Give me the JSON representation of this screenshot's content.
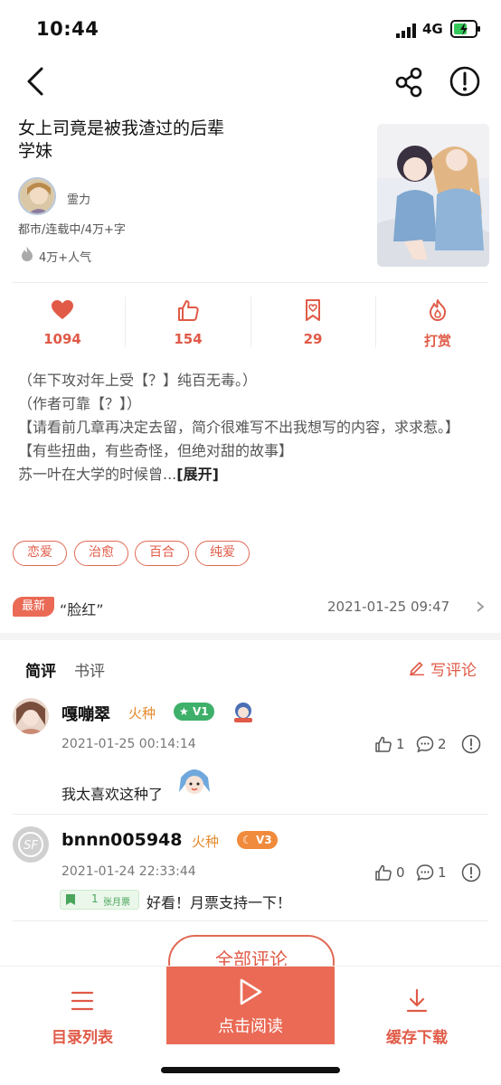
{
  "status": {
    "time": "10:44",
    "network": "4G"
  },
  "book": {
    "title": "女上司竟是被我渣过的后辈学妹",
    "author": "霊力",
    "meta": "都市/连载中/4万+字",
    "popularity": "4万+人气"
  },
  "stats": [
    {
      "value": "1094",
      "icon": "heart-icon"
    },
    {
      "value": "154",
      "icon": "thumbs-up-icon"
    },
    {
      "value": "29",
      "icon": "bookmark-ticket-icon"
    },
    {
      "value": "打赏",
      "icon": "flame-reward-icon"
    }
  ],
  "intro": {
    "lines": [
      "（年下攻对年上受【？】纯百无毒。）",
      "（作者可靠【？】）",
      "【请看前几章再决定去留，简介很难写不出我想写的内容，求求惹。】",
      "【有些扭曲，有些奇怪，但绝对甜的故事】",
      "苏一叶在大学的时候曾..."
    ],
    "expand": "[展开]"
  },
  "tags": [
    "恋爱",
    "治愈",
    "百合",
    "纯爱"
  ],
  "latest": {
    "badge": "最新",
    "title": "“脸红”",
    "date": "2021-01-25 09:47"
  },
  "reviews": {
    "tab_short": "简评",
    "tab_book": "书评",
    "write": "写评论",
    "all": "全部评论"
  },
  "comments": [
    {
      "name": "嘎嘣翠",
      "level": "火种",
      "badge": "V1",
      "date": "2021-01-25 00:14:14",
      "likes": "1",
      "replies": "2",
      "text": "我太喜欢这种了"
    },
    {
      "name": "bnnn005948",
      "level": "火种",
      "badge": "V3",
      "date": "2021-01-24 22:33:44",
      "likes": "0",
      "replies": "1",
      "ticket_count": "1",
      "ticket_label": "张月票",
      "text": "好看！月票支持一下！"
    }
  ],
  "bottom": {
    "toc": "目录列表",
    "read": "点击阅读",
    "download": "缓存下载"
  },
  "colors": {
    "accent": "#e05a47",
    "accent_fill": "#ea6a55",
    "level": "#e58a2c",
    "vip_green": "#3fb06a",
    "vip_orange": "#f08a3c"
  }
}
